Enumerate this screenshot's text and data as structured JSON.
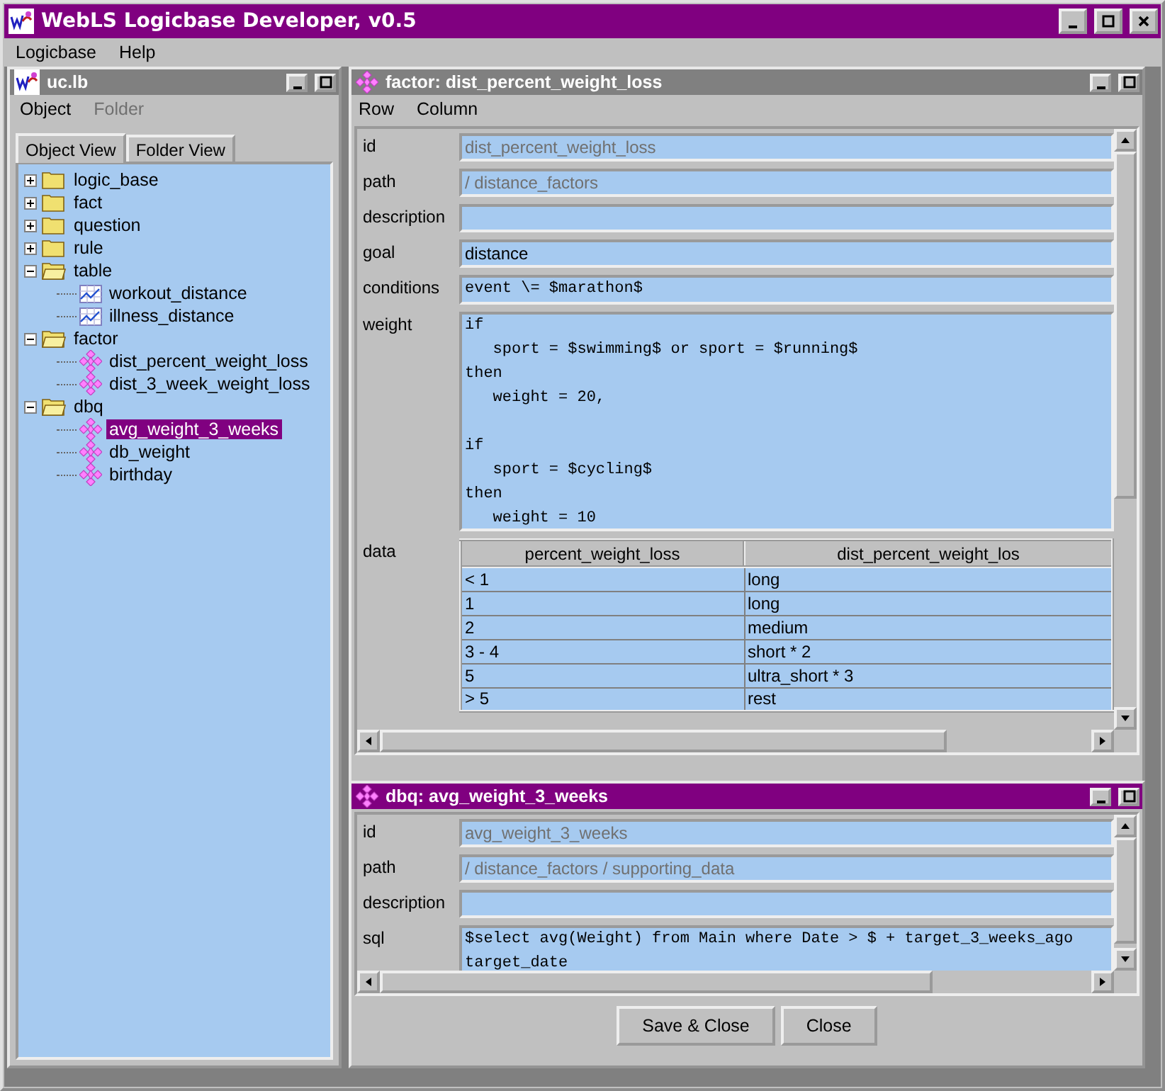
{
  "window": {
    "title": "WebLS Logicbase Developer, v0.5"
  },
  "menu": [
    "Logicbase",
    "Help"
  ],
  "explorer": {
    "title": "uc.lb",
    "menu": [
      {
        "label": "Object",
        "disabled": false
      },
      {
        "label": "Folder",
        "disabled": true
      }
    ],
    "tabs": [
      {
        "label": "Object View",
        "selected": true
      },
      {
        "label": "Folder View",
        "selected": false
      }
    ],
    "tree": [
      {
        "label": "logic_base",
        "kind": "folder",
        "expanded": false,
        "selected": false
      },
      {
        "label": "fact",
        "kind": "folder",
        "expanded": false,
        "selected": false
      },
      {
        "label": "question",
        "kind": "folder",
        "expanded": false,
        "selected": false
      },
      {
        "label": "rule",
        "kind": "folder",
        "expanded": false,
        "selected": false
      },
      {
        "label": "table",
        "kind": "folder",
        "expanded": true,
        "selected": false,
        "children": [
          {
            "label": "workout_distance",
            "kind": "table",
            "selected": false
          },
          {
            "label": "illness_distance",
            "kind": "table",
            "selected": false
          }
        ]
      },
      {
        "label": "factor",
        "kind": "folder",
        "expanded": true,
        "selected": false,
        "children": [
          {
            "label": "dist_percent_weight_loss",
            "kind": "object",
            "selected": false
          },
          {
            "label": "dist_3_week_weight_loss",
            "kind": "object",
            "selected": false
          }
        ]
      },
      {
        "label": "dbq",
        "kind": "folder",
        "expanded": true,
        "selected": false,
        "children": [
          {
            "label": "avg_weight_3_weeks",
            "kind": "object",
            "selected": true
          },
          {
            "label": "db_weight",
            "kind": "object",
            "selected": false
          },
          {
            "label": "birthday",
            "kind": "object",
            "selected": false
          }
        ]
      }
    ]
  },
  "factor_frame": {
    "title": "factor: dist_percent_weight_loss",
    "active": false,
    "menu": [
      "Row",
      "Column"
    ],
    "fields": [
      {
        "label": "id",
        "kind": "text",
        "value": "dist_percent_weight_loss",
        "disabled": true
      },
      {
        "label": "path",
        "kind": "text",
        "value": "/ distance_factors",
        "disabled": true
      },
      {
        "label": "description",
        "kind": "text"
      },
      {
        "label": "goal",
        "kind": "text",
        "value": "distance",
        "disabled": false
      },
      {
        "label": "conditions",
        "kind": "code",
        "lines": [
          "event \\= $marathon$"
        ],
        "disabled": false
      },
      {
        "label": "weight",
        "kind": "code",
        "lines": [
          "if\n   sport = $swimming$ or sport = $running$\nthen\n   weight = 20,\n\nif\n   sport = $cycling$\nthen\n   weight = 10"
        ],
        "disabled": false
      },
      {
        "label": "data",
        "kind": "table",
        "columns": [
          "percent_weight_loss",
          "dist_percent_weight_los"
        ],
        "rows": [
          [
            "< 1",
            "long"
          ],
          [
            "1",
            "long"
          ],
          [
            "2",
            "medium"
          ],
          [
            "3 - 4",
            "short * 2"
          ],
          [
            "5",
            "ultra_short * 3"
          ],
          [
            "> 5",
            "rest"
          ]
        ]
      }
    ]
  },
  "dbq_frame": {
    "title": "dbq: avg_weight_3_weeks",
    "active": true,
    "fields": [
      {
        "label": "id",
        "kind": "text",
        "value": "avg_weight_3_weeks",
        "disabled": true
      },
      {
        "label": "path",
        "kind": "text",
        "value": "/ distance_factors / supporting_data",
        "disabled": true
      },
      {
        "label": "description",
        "kind": "text"
      },
      {
        "label": "sql",
        "kind": "code",
        "lines": [
          "$select avg(Weight) from Main where Date > $ + target_3_weeks_ago",
          "target_date"
        ],
        "disabled": false
      }
    ],
    "buttons": [
      "Save & Close",
      "Close"
    ]
  }
}
